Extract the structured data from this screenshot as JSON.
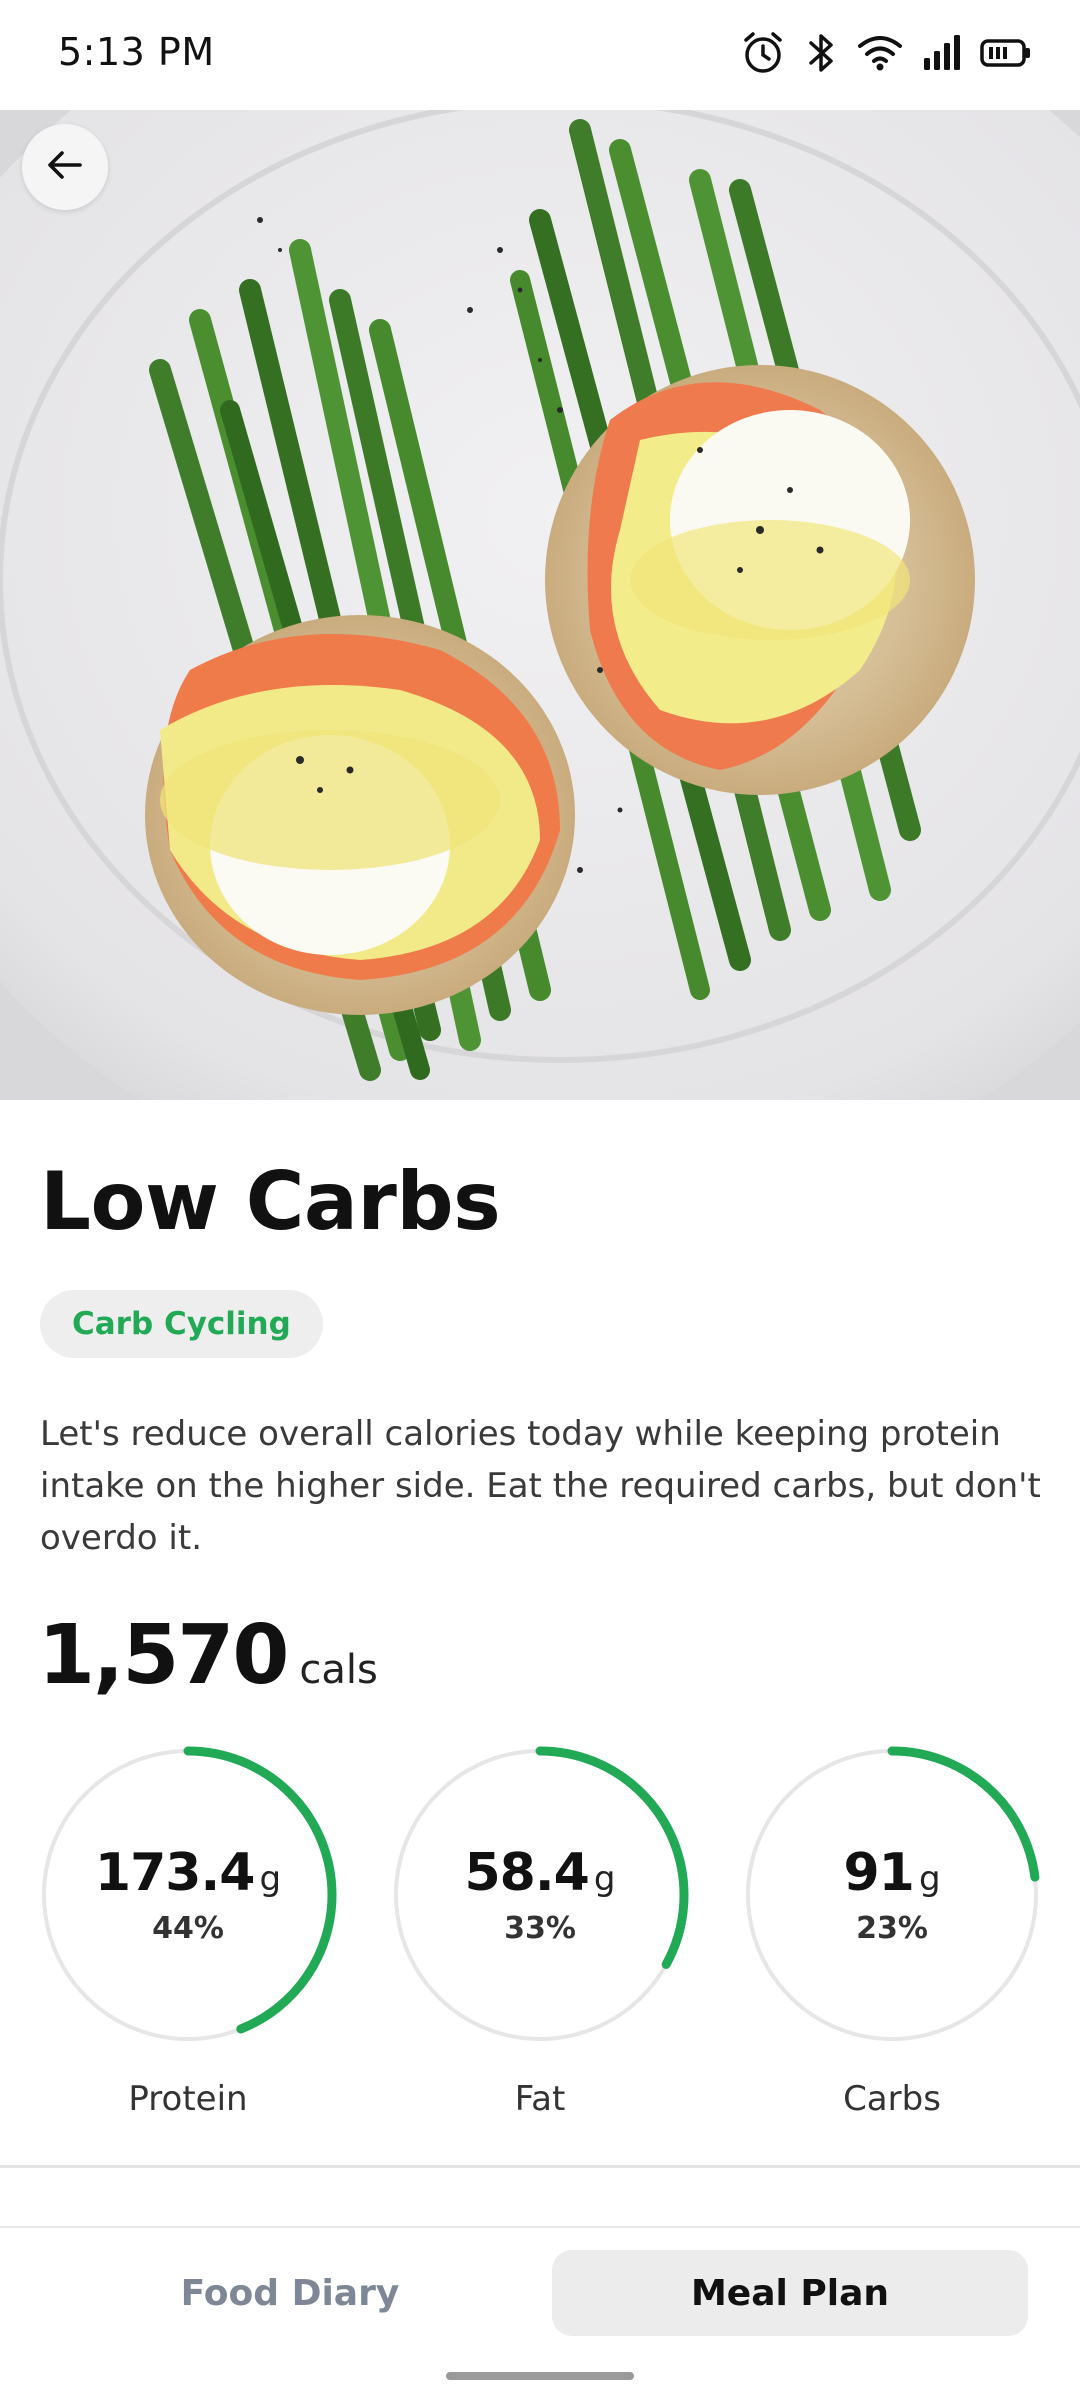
{
  "status_bar": {
    "time": "5:13 PM",
    "icons": [
      "alarm-icon",
      "bluetooth-icon",
      "wifi-icon",
      "signal-icon",
      "battery-icon"
    ]
  },
  "header": {
    "back_icon": "arrow-left-icon"
  },
  "hero": {
    "image": "plate of eggs benedict with smoked salmon and asparagus"
  },
  "meal": {
    "title": "Low Carbs",
    "tag": "Carb Cycling",
    "description": "Let's reduce overall calories today while keeping protein intake on the higher side. Eat the required carbs, but don't overdo it.",
    "calories_value": "1,570",
    "calories_unit": "cals"
  },
  "macros": [
    {
      "name": "Protein",
      "value": "173.4",
      "unit": "g",
      "percent_label": "44%",
      "percent": 44
    },
    {
      "name": "Fat",
      "value": "58.4",
      "unit": "g",
      "percent_label": "33%",
      "percent": 33
    },
    {
      "name": "Carbs",
      "value": "91",
      "unit": "g",
      "percent_label": "23%",
      "percent": 23
    }
  ],
  "bottom_tabs": {
    "food_diary": "Food Diary",
    "meal_plan": "Meal Plan",
    "active": "meal_plan"
  },
  "colors": {
    "accent": "#21a956",
    "ring_track": "#e6e6e6",
    "tab_inactive": "#7d8795"
  }
}
